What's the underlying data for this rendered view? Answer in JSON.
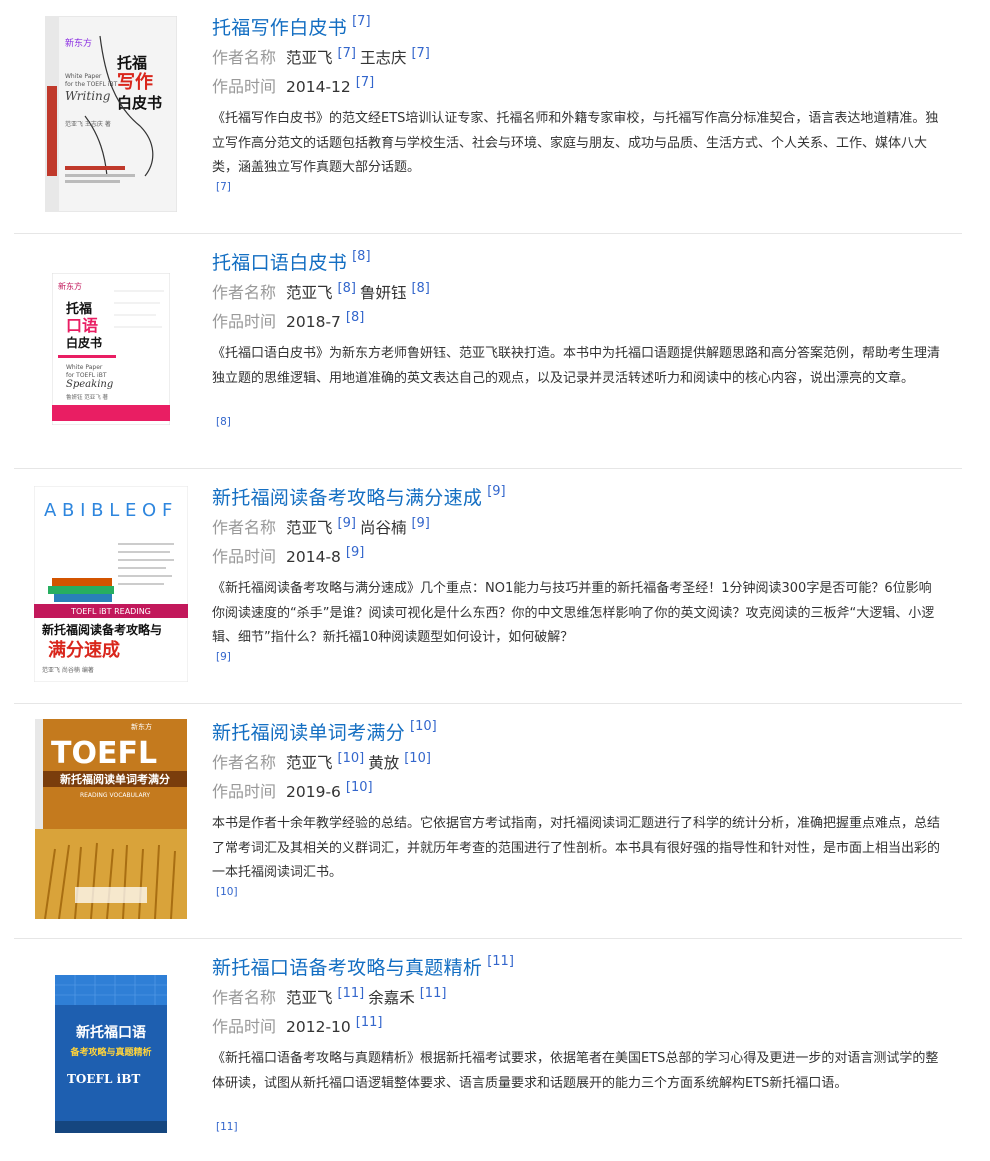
{
  "labels": {
    "author": "作者名称",
    "date": "作品时间"
  },
  "works": [
    {
      "title": "托福写作白皮书",
      "ref": "[7]",
      "authors": [
        {
          "name": "范亚飞",
          "ref": "[7]"
        },
        {
          "name": "王志庆",
          "ref": "[7]"
        }
      ],
      "date": "2014-12",
      "date_ref": "[7]",
      "description": "《托福写作白皮书》的范文经ETS培训认证专家、托福名师和外籍专家审校，与托福写作高分标准契合，语言表达地道精准。独立写作高分范文的话题包括教育与学校生活、社会与环境、家庭与朋友、成功与品质、生活方式、个人关系、工作、媒体八大类，涵盖独立写作真题大部分话题。",
      "desc_ref": "[7]",
      "cover": {
        "alt": "托福写作白皮书 封面",
        "publisher": "新东方",
        "title_lines": [
          "托福",
          "写作",
          "白皮书"
        ],
        "english": [
          "White Paper",
          "for the TOEFL iBT",
          "Writing"
        ],
        "authors_text": "范亚飞 王志庆 著"
      }
    },
    {
      "title": "托福口语白皮书",
      "ref": "[8]",
      "authors": [
        {
          "name": "范亚飞",
          "ref": "[8]"
        },
        {
          "name": "鲁妍钰",
          "ref": "[8]"
        }
      ],
      "date": "2018-7",
      "date_ref": "[8]",
      "description": "《托福口语白皮书》为新东方老师鲁妍钰、范亚飞联袂打造。本书中为托福口语题提供解题思路和高分答案范例，帮助考生理清独立题的思维逻辑、用地道准确的英文表达自己的观点，以及记录并灵活转述听力和阅读中的核心内容，说出漂亮的文章。",
      "desc_ref": "[8]",
      "cover": {
        "alt": "托福口语白皮书 封面",
        "publisher": "新东方",
        "title_lines": [
          "托福",
          "口语",
          "白皮书"
        ],
        "english": [
          "White Paper",
          "for TOEFL iBT",
          "Speaking"
        ],
        "authors_text": "鲁妍钰 范亚飞 著"
      }
    },
    {
      "title": "新托福阅读备考攻略与满分速成",
      "ref": "[9]",
      "authors": [
        {
          "name": "范亚飞",
          "ref": "[9]"
        },
        {
          "name": "尚谷楠",
          "ref": "[9]"
        }
      ],
      "date": "2014-8",
      "date_ref": "[9]",
      "description": "《新托福阅读备考攻略与满分速成》几个重点：NO1能力与技巧并重的新托福备考圣经！1分钟阅读300字是否可能？6位影响你阅读速度的“杀手”是谁？阅读可视化是什么东西？你的中文思维怎样影响了你的英文阅读？攻克阅读的三板斧“大逻辑、小逻辑、细节”指什么？新托福10种阅读题型如何设计，如何破解？",
      "desc_ref": "[9]",
      "cover": {
        "alt": "新托福阅读备考攻略与满分速成 封面",
        "banner": "TOEFL iBT READING",
        "title_lines": [
          "新托福阅读备考攻略与",
          "满分速成"
        ],
        "letters": "A B I B L E O F",
        "authors_text": "范亚飞  尚谷楠 编著"
      }
    },
    {
      "title": "新托福阅读单词考满分",
      "ref": "[10]",
      "authors": [
        {
          "name": "范亚飞",
          "ref": "[10]"
        },
        {
          "name": "黄放",
          "ref": "[10]"
        }
      ],
      "date": "2019-6",
      "date_ref": "[10]",
      "description": "本书是作者十余年教学经验的总结。它依据官方考试指南，对托福阅读词汇题进行了科学的统计分析，准确把握重点难点，总结了常考词汇及其相关的义群词汇，并就历年考查的范围进行了性剖析。本书具有很好强的指导性和针对性，是市面上相当出彩的一本托福阅读词汇书。",
      "desc_ref": "[10]",
      "cover": {
        "alt": "新托福阅读单词考满分 封面",
        "publisher": "新东方",
        "big": "TOEFL",
        "title_line": "新托福阅读单词考满分",
        "sub": "READING VOCABULARY"
      }
    },
    {
      "title": "新托福口语备考攻略与真题精析",
      "ref": "[11]",
      "authors": [
        {
          "name": "范亚飞",
          "ref": "[11]"
        },
        {
          "name": "余嘉禾",
          "ref": "[11]"
        }
      ],
      "date": "2012-10",
      "date_ref": "[11]",
      "description": "《新托福口语备考攻略与真题精析》根据新托福考试要求，依据笔者在美国ETS总部的学习心得及更进一步的对语言测试学的整体研读，试图从新托福口语逻辑整体要求、语言质量要求和话题展开的能力三个方面系统解构ETS新托福口语。",
      "desc_ref": "[11]",
      "cover": {
        "alt": "新托福口语备考攻略与真题精析 封面",
        "title_line": "新托福口语",
        "sub_line": "备考攻略与真题精析",
        "english": "TOEFL iBT"
      }
    }
  ],
  "colors": {
    "title_link": "#136ec2",
    "ref_link": "#3366cc",
    "label": "#999999",
    "text": "#333333",
    "divider": "#e6e6e6"
  }
}
